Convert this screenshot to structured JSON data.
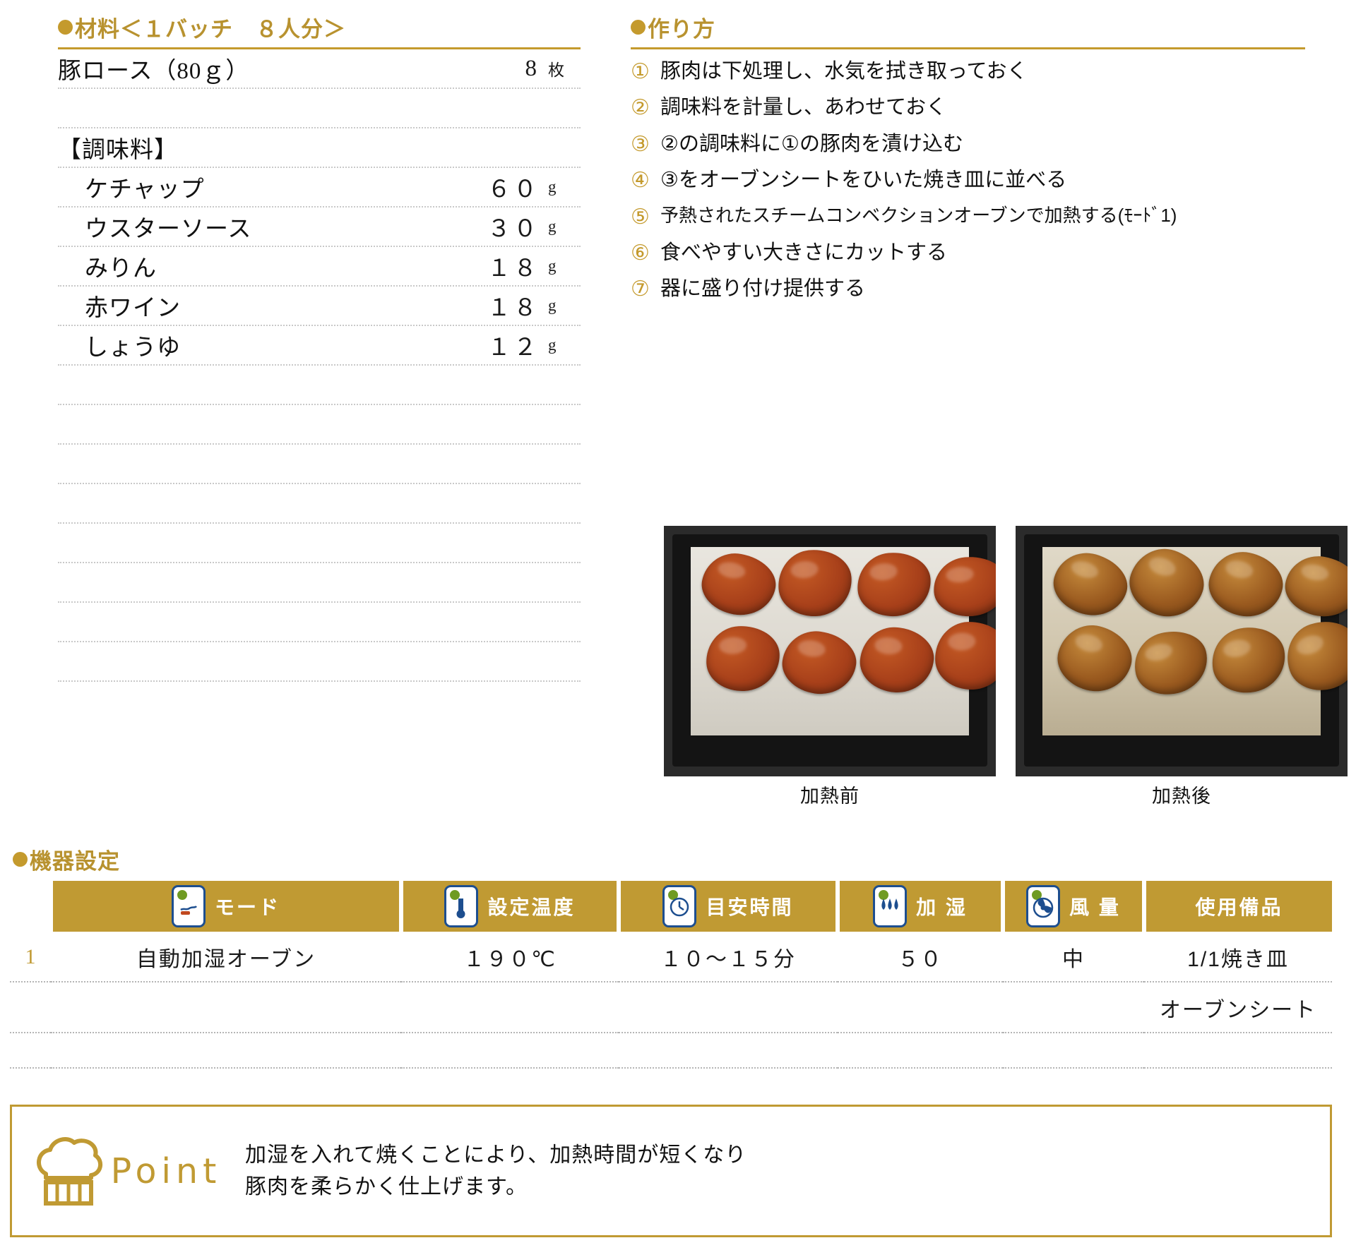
{
  "ingredients": {
    "heading": "●材料＜１バッチ　８人分＞",
    "heading_text": "材料＜１バッチ　８人分＞",
    "rows": [
      {
        "name": "豚ロース（80ｇ）",
        "qty": "8",
        "unit": "枚",
        "indent": false
      },
      {
        "name": "",
        "qty": "",
        "unit": "",
        "indent": false
      },
      {
        "name": "【調味料】",
        "qty": "",
        "unit": "",
        "indent": false
      },
      {
        "name": "ケチャップ",
        "qty": "６０",
        "unit": "g",
        "indent": true
      },
      {
        "name": "ウスターソース",
        "qty": "３０",
        "unit": "g",
        "indent": true
      },
      {
        "name": "みりん",
        "qty": "１８",
        "unit": "g",
        "indent": true
      },
      {
        "name": "赤ワイン",
        "qty": "１８",
        "unit": "g",
        "indent": true
      },
      {
        "name": "しょうゆ",
        "qty": "１２",
        "unit": "g",
        "indent": true
      },
      {
        "name": "",
        "qty": "",
        "unit": "",
        "indent": false
      },
      {
        "name": "",
        "qty": "",
        "unit": "",
        "indent": false
      },
      {
        "name": "",
        "qty": "",
        "unit": "",
        "indent": false
      },
      {
        "name": "",
        "qty": "",
        "unit": "",
        "indent": false
      },
      {
        "name": "",
        "qty": "",
        "unit": "",
        "indent": false
      },
      {
        "name": "",
        "qty": "",
        "unit": "",
        "indent": false
      },
      {
        "name": "",
        "qty": "",
        "unit": "",
        "indent": false
      },
      {
        "name": "",
        "qty": "",
        "unit": "",
        "indent": false
      }
    ]
  },
  "method": {
    "heading_text": "作り方",
    "steps": [
      {
        "num": "①",
        "text": "豚肉は下処理し、水気を拭き取っておく",
        "small": false
      },
      {
        "num": "②",
        "text": "調味料を計量し、あわせておく",
        "small": false
      },
      {
        "num": "③",
        "text": "②の調味料に①の豚肉を漬け込む",
        "small": false
      },
      {
        "num": "④",
        "text": "③をオーブンシートをひいた焼き皿に並べる",
        "small": false
      },
      {
        "num": "⑤",
        "text": "予熱されたスチームコンベクションオーブンで加熱する(ﾓｰﾄﾞ1)",
        "small": true
      },
      {
        "num": "⑥",
        "text": "食べやすい大きさにカットする",
        "small": false
      },
      {
        "num": "⑦",
        "text": "器に盛り付け提供する",
        "small": false
      }
    ]
  },
  "photos": [
    {
      "caption": "加熱前",
      "state": "raw"
    },
    {
      "caption": "加熱後",
      "state": "cooked"
    }
  ],
  "equipment": {
    "heading_text": "機器設定",
    "columns": [
      {
        "label": "モード",
        "icon": "mode-icon"
      },
      {
        "label": "設定温度",
        "icon": "thermometer-icon"
      },
      {
        "label": "目安時間",
        "icon": "clock-icon"
      },
      {
        "label": "加 湿",
        "icon": "humidity-icon"
      },
      {
        "label": "風 量",
        "icon": "fan-icon"
      },
      {
        "label": "使用備品",
        "icon": ""
      }
    ],
    "rows": [
      {
        "index": "1",
        "mode": "自動加湿オーブン",
        "temperature": "１９０℃",
        "time": "１０～１５分",
        "humidity": "５０",
        "airflow": "中",
        "equipment": "1/1焼き皿"
      },
      {
        "index": "",
        "mode": "",
        "temperature": "",
        "time": "",
        "humidity": "",
        "airflow": "",
        "equipment": "オーブンシート"
      }
    ]
  },
  "point": {
    "title": "Point",
    "line1": "加湿を入れて焼くことにより、加熱時間が短くなり",
    "line2": "豚肉を柔らかく仕上げます。"
  },
  "colors": {
    "gold": "#c49a2d",
    "gold_band": "#c09a33",
    "icon_blue": "#1d4e8f",
    "dotted": "#c9c9c9"
  }
}
